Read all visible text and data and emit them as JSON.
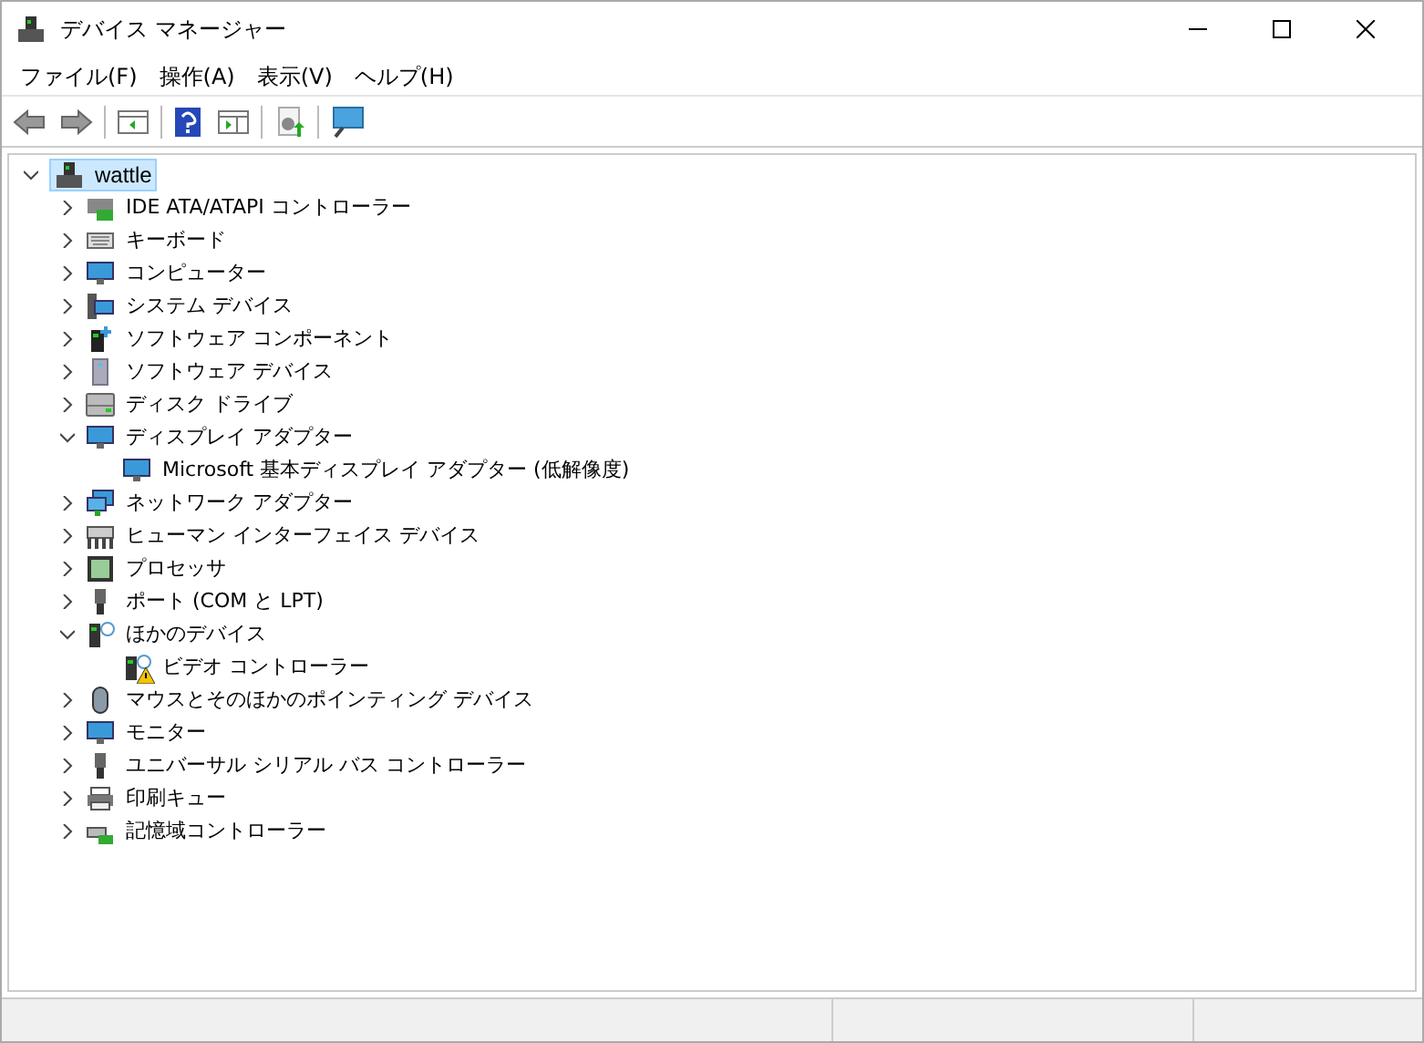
{
  "window": {
    "title": "デバイス マネージャー"
  },
  "menu": [
    "ファイル(F)",
    "操作(A)",
    "表示(V)",
    "ヘルプ(H)"
  ],
  "tree": {
    "label": "wattle",
    "selected": true,
    "expanded": true,
    "children": [
      {
        "label": "IDE ATA/ATAPI コントローラー",
        "expanded": false
      },
      {
        "label": "キーボード",
        "expanded": false
      },
      {
        "label": "コンピューター",
        "expanded": false
      },
      {
        "label": "システム デバイス",
        "expanded": false
      },
      {
        "label": "ソフトウェア コンポーネント",
        "expanded": false
      },
      {
        "label": "ソフトウェア デバイス",
        "expanded": false
      },
      {
        "label": "ディスク ドライブ",
        "expanded": false
      },
      {
        "label": "ディスプレイ アダプター",
        "expanded": true,
        "children": [
          {
            "label": "Microsoft 基本ディスプレイ アダプター (低解像度)",
            "warning": false
          }
        ]
      },
      {
        "label": "ネットワーク アダプター",
        "expanded": false
      },
      {
        "label": "ヒューマン インターフェイス デバイス",
        "expanded": false
      },
      {
        "label": "プロセッサ",
        "expanded": false
      },
      {
        "label": "ポート (COM と LPT)",
        "expanded": false
      },
      {
        "label": "ほかのデバイス",
        "expanded": true,
        "children": [
          {
            "label": "ビデオ コントローラー",
            "warning": true
          }
        ]
      },
      {
        "label": "マウスとそのほかのポインティング デバイス",
        "expanded": false
      },
      {
        "label": "モニター",
        "expanded": false
      },
      {
        "label": "ユニバーサル シリアル バス コントローラー",
        "expanded": false
      },
      {
        "label": "印刷キュー",
        "expanded": false
      },
      {
        "label": "記憶域コントローラー",
        "expanded": false
      }
    ]
  }
}
